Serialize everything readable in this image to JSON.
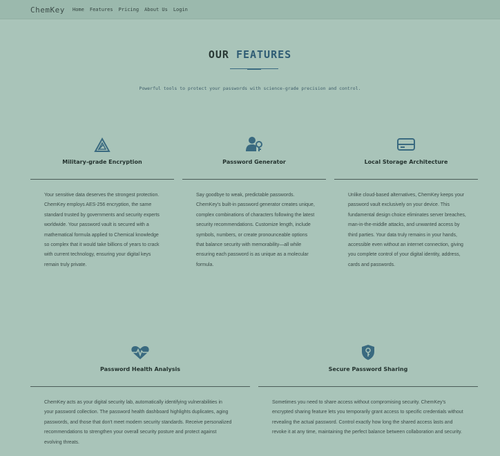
{
  "nav": {
    "logo": "ChemKey",
    "links": [
      "Home",
      "Features",
      "Pricing",
      "About Us",
      "Login"
    ]
  },
  "hero": {
    "title_part1": "OUR",
    "title_part2": "FEATURES",
    "subtitle": "Powerful tools to protect your passwords with science-grade precision and control."
  },
  "features": [
    {
      "icon": "triangle-icon",
      "title": "Military-grade Encryption",
      "description": "Your sensitive data deserves the strongest protection. ChemKey employs AES-256 encryption, the same standard trusted by governments and security experts worldwide. Your password vault is secured with a mathematical formula applied to Chemical knowledge so complex that it would take billions of years to crack with current technology, ensuring your digital keys remain truly private."
    },
    {
      "icon": "user-key-icon",
      "title": "Password Generator",
      "description": "Say goodbye to weak, predictable passwords. ChemKey's built-in password generator creates unique, complex combinations of characters following the latest security recommendations. Customize length, include symbols, numbers, or create pronounceable options that balance security with memorability—all while ensuring each password is as unique as a molecular formula."
    },
    {
      "icon": "hard-drive-icon",
      "title": "Local Storage Architecture",
      "description": "Unlike cloud-based alternatives, ChemKey keeps your password vault exclusively on your device. This fundamental design choice eliminates server breaches, man-in-the-middle attacks, and unwanted access by third parties. Your data truly remains in your hands, accessible even without an internet connection, giving you complete control of your digital identity, address, cards and passwords."
    },
    {
      "icon": "heart-pulse-icon",
      "title": "Password Health Analysis",
      "description": "ChemKey acts as your digital security lab, automatically identifying vulnerabilities in your password collection. The password health dashboard highlights duplicates, aging passwords, and those that don't meet modern security standards. Receive personalized recommendations to strengthen your overall security posture and protect against evolving threats."
    },
    {
      "icon": "shield-key-icon",
      "title": "Secure Password Sharing",
      "description": "Sometimes you need to share access without compromising security. ChemKey's encrypted sharing feature lets you temporarily grant access to specific credentials without revealing the actual password. Control exactly how long the shared access lasts and revoke it at any time, maintaining the perfect balance between collaboration and security."
    }
  ],
  "colors": {
    "background": "#a9c4b9",
    "navbar": "#9bb9ad",
    "accent": "#3a6a80",
    "text": "#2a3a36"
  }
}
